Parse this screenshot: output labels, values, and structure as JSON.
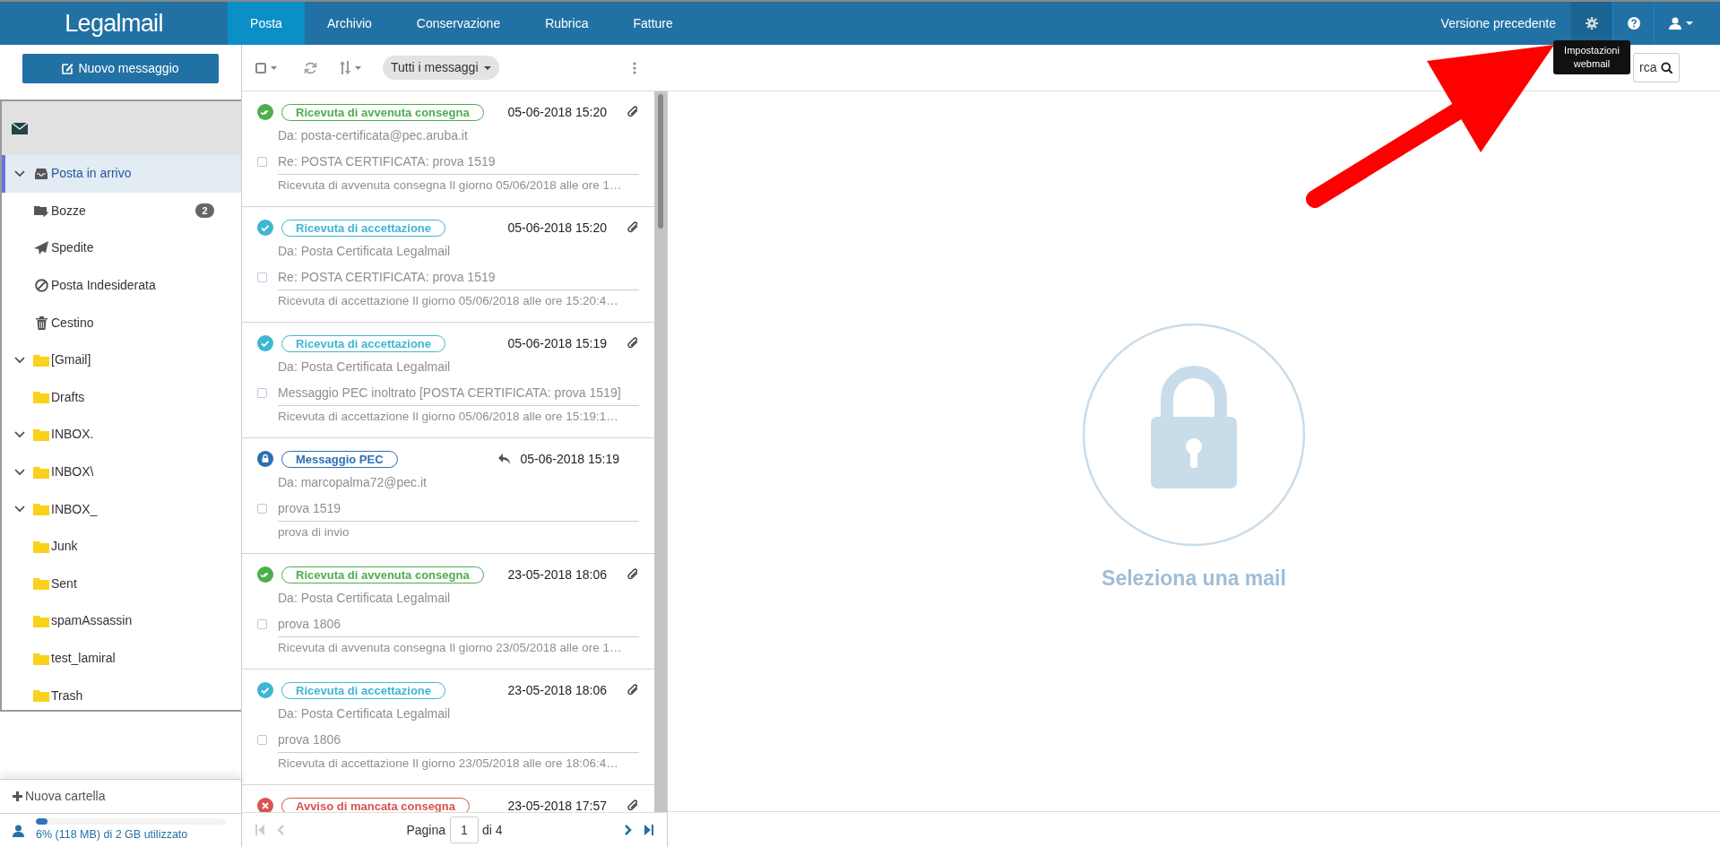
{
  "header": {
    "logo": "Legalmail",
    "nav": [
      {
        "label": "Posta",
        "selected": true
      },
      {
        "label": "Archivio",
        "selected": false
      },
      {
        "label": "Conservazione",
        "selected": false
      },
      {
        "label": "Rubrica",
        "selected": false
      },
      {
        "label": "Fatture",
        "selected": false
      }
    ],
    "previous_version": "Versione precedente",
    "tooltip": "Impostazioni webmail"
  },
  "sidebar": {
    "new_message": "Nuovo messaggio",
    "folders": [
      {
        "kind": "inbox",
        "label": "Posta in arrivo",
        "selected": true,
        "expanded": true
      },
      {
        "kind": "drafts",
        "label": "Bozze",
        "selected": false,
        "count": "2"
      },
      {
        "kind": "sent",
        "label": "Spedite",
        "selected": false
      },
      {
        "kind": "spam",
        "label": "Posta Indesiderata",
        "selected": false
      },
      {
        "kind": "trash",
        "label": "Cestino",
        "selected": false
      },
      {
        "kind": "folder",
        "label": "[Gmail]",
        "selected": false,
        "expanded": true
      },
      {
        "kind": "folder",
        "label": "Drafts",
        "selected": false
      },
      {
        "kind": "folder",
        "label": "INBOX.",
        "selected": false,
        "expanded": true
      },
      {
        "kind": "folder",
        "label": "INBOX\\",
        "selected": false,
        "expanded": true
      },
      {
        "kind": "folder",
        "label": "INBOX_",
        "selected": false,
        "expanded": true
      },
      {
        "kind": "folder",
        "label": "Junk",
        "selected": false
      },
      {
        "kind": "folder",
        "label": "Sent",
        "selected": false
      },
      {
        "kind": "folder",
        "label": "spamAssassin",
        "selected": false
      },
      {
        "kind": "folder",
        "label": "test_lamiral",
        "selected": false
      },
      {
        "kind": "folder",
        "label": "Trash",
        "selected": false
      }
    ],
    "new_folder": "Nuova cartella",
    "storage": {
      "level": 0.06,
      "text": "6% (118 MB) di 2 GB utilizzato"
    }
  },
  "toolbar": {
    "filter": "Tutti i messaggi",
    "search_placeholder": "rca"
  },
  "messages": [
    {
      "kind": "delivered",
      "badge": "Ricevuta di avvenuta consegna",
      "date": "05-06-2018 15:20",
      "attachment": true,
      "replied": false,
      "checked": false,
      "from": "Da: posta-certificata@pec.aruba.it",
      "subject": "Re: POSTA CERTIFICATA: prova 1519",
      "preview": "Ricevuta di avvenuta consegna Il giorno 05/06/2018 alle ore 1…"
    },
    {
      "kind": "accepted",
      "badge": "Ricevuta di accettazione",
      "date": "05-06-2018 15:20",
      "attachment": true,
      "replied": false,
      "checked": false,
      "from": "Da: Posta Certificata Legalmail",
      "subject": "Re: POSTA CERTIFICATA: prova 1519",
      "preview": "Ricevuta di accettazione Il giorno 05/06/2018 alle ore 15:20:4…"
    },
    {
      "kind": "accepted",
      "badge": "Ricevuta di accettazione",
      "date": "05-06-2018 15:19",
      "attachment": true,
      "replied": false,
      "checked": false,
      "from": "Da: Posta Certificata Legalmail",
      "subject": "Messaggio PEC inoltrato [POSTA CERTIFICATA: prova 1519]",
      "preview": "Ricevuta di accettazione Il giorno 05/06/2018 alle ore 15:19:1…"
    },
    {
      "kind": "pec",
      "badge": "Messaggio PEC",
      "date": "05-06-2018 15:19",
      "attachment": false,
      "replied": true,
      "checked": false,
      "from": "Da: marcopalma72@pec.it",
      "subject": "prova 1519",
      "preview": "prova di invio"
    },
    {
      "kind": "delivered",
      "badge": "Ricevuta di avvenuta consegna",
      "date": "23-05-2018 18:06",
      "attachment": true,
      "replied": false,
      "checked": false,
      "from": "Da: Posta Certificata Legalmail",
      "subject": "prova 1806",
      "preview": "Ricevuta di avvenuta consegna Il giorno 23/05/2018 alle ore 1…"
    },
    {
      "kind": "accepted",
      "badge": "Ricevuta di accettazione",
      "date": "23-05-2018 18:06",
      "attachment": true,
      "replied": false,
      "checked": false,
      "from": "Da: Posta Certificata Legalmail",
      "subject": "prova 1806",
      "preview": "Ricevuta di accettazione Il giorno 23/05/2018 alle ore 18:06:4…"
    },
    {
      "kind": "failed",
      "badge": "Avviso di mancata consegna",
      "date": "23-05-2018 17:57",
      "attachment": true,
      "replied": false
    }
  ],
  "pagination": {
    "label": "Pagina",
    "page": "1",
    "of": "di 4"
  },
  "reading_pane": {
    "empty_text": "Seleziona una mail"
  }
}
